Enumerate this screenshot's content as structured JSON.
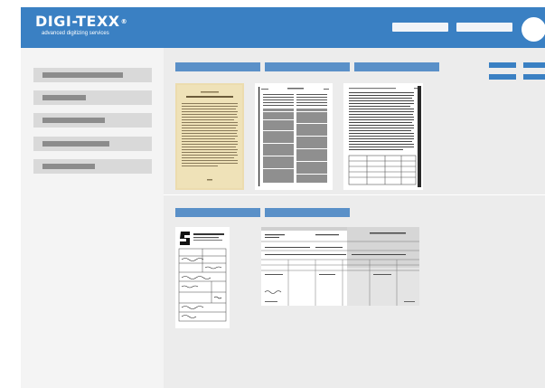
{
  "header": {
    "logo_text": "DIGI-TEXX",
    "logo_mark": "®",
    "logo_tagline": "advanced digitizing services",
    "background": "#3a80c3"
  },
  "sidebar": {
    "items": [
      {
        "name": "sidebar-item-1"
      },
      {
        "name": "sidebar-item-2"
      },
      {
        "name": "sidebar-item-3"
      },
      {
        "name": "sidebar-item-4"
      },
      {
        "name": "sidebar-item-5"
      }
    ]
  },
  "main": {
    "section_1": {
      "tabs": 3,
      "documents": [
        "book-page-document",
        "newspaper-document",
        "text-page-document"
      ]
    },
    "section_2": {
      "tabs": 2,
      "documents": [
        "form-document",
        "ledger-document"
      ]
    }
  },
  "colors": {
    "accent": "#3a80c3",
    "tab": "#5a90c8",
    "sidebar_item": "#d9d9d9",
    "background": "#f4f4f4"
  }
}
